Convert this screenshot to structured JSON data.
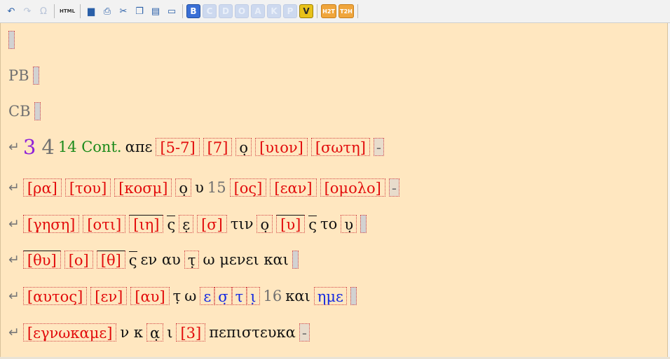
{
  "toolbar": {
    "undo": "↶",
    "redo": "↷",
    "omega": "Ω",
    "html": "HTML",
    "save": "▆",
    "print": "⎙",
    "cut": "✂",
    "copy": "❐",
    "paste": "▤",
    "view": "▭",
    "lettersB": "B",
    "lettersC": "C",
    "lettersD": "D",
    "lettersO": "O",
    "lettersA": "A",
    "lettersK": "K",
    "lettersP": "P",
    "lettersV": "V",
    "h2t": "H2T",
    "t2h": "T2H"
  },
  "editor": {
    "line2": "PB",
    "line3": "CB",
    "l4": {
      "ret": "↵",
      "n1": "3",
      "n2": "4",
      "cont": "14 Cont.",
      "t1": "απε",
      "b1": "[5-7]",
      "b2": "[7]",
      "b3": "ο̣",
      "b4": "[υιον]",
      "b5": "[σωτη]",
      "dash": "-"
    },
    "l5": {
      "ret": "↵",
      "b1": "[ρα]",
      "b2": "[του]",
      "b3": "[κοσμ]",
      "b4": "ο̣",
      "t1": "υ",
      "n1": "15",
      "b5": "[ος]",
      "b6": "[εαν]",
      "b7": "[ομολο]",
      "dash": "-"
    },
    "l6": {
      "ret": "↵",
      "b1": "[γηση]",
      "b2": "[οτι]",
      "b3": "[ιη]",
      "t1": "ς",
      "b4": "ε̣",
      "b5": "[σ]",
      "t2": "τιν",
      "b6": "ο̣",
      "b7": "[υ]",
      "t3": "ς",
      "t4": "το",
      "b8": "υ̣"
    },
    "l7": {
      "ret": "↵",
      "b1": "[θυ]",
      "b2": "[ο]",
      "b3": "[θ]",
      "t1": "ς",
      "t2": "εν αυ",
      "b4": "τ̣",
      "t3": "ω μενει και"
    },
    "l8": {
      "ret": "↵",
      "b1": "[αυτος]",
      "b2": "[εν]",
      "b3": "[αυ]",
      "t1": "τ̣",
      "t2": "ω",
      "bl1": "ε",
      "bl2": "σ̣",
      "bl3": "τ",
      "bl4": "ι̣",
      "n1": "16",
      "t3": "και",
      "bl5": "ημε"
    },
    "l9": {
      "ret": "↵",
      "b1": "[εγνωκαμε]",
      "t1": "ν κ",
      "b2": "α̣",
      "t2": "ι",
      "b3": "[3]",
      "t3": "πεπιστευκα",
      "dash": "-"
    }
  }
}
